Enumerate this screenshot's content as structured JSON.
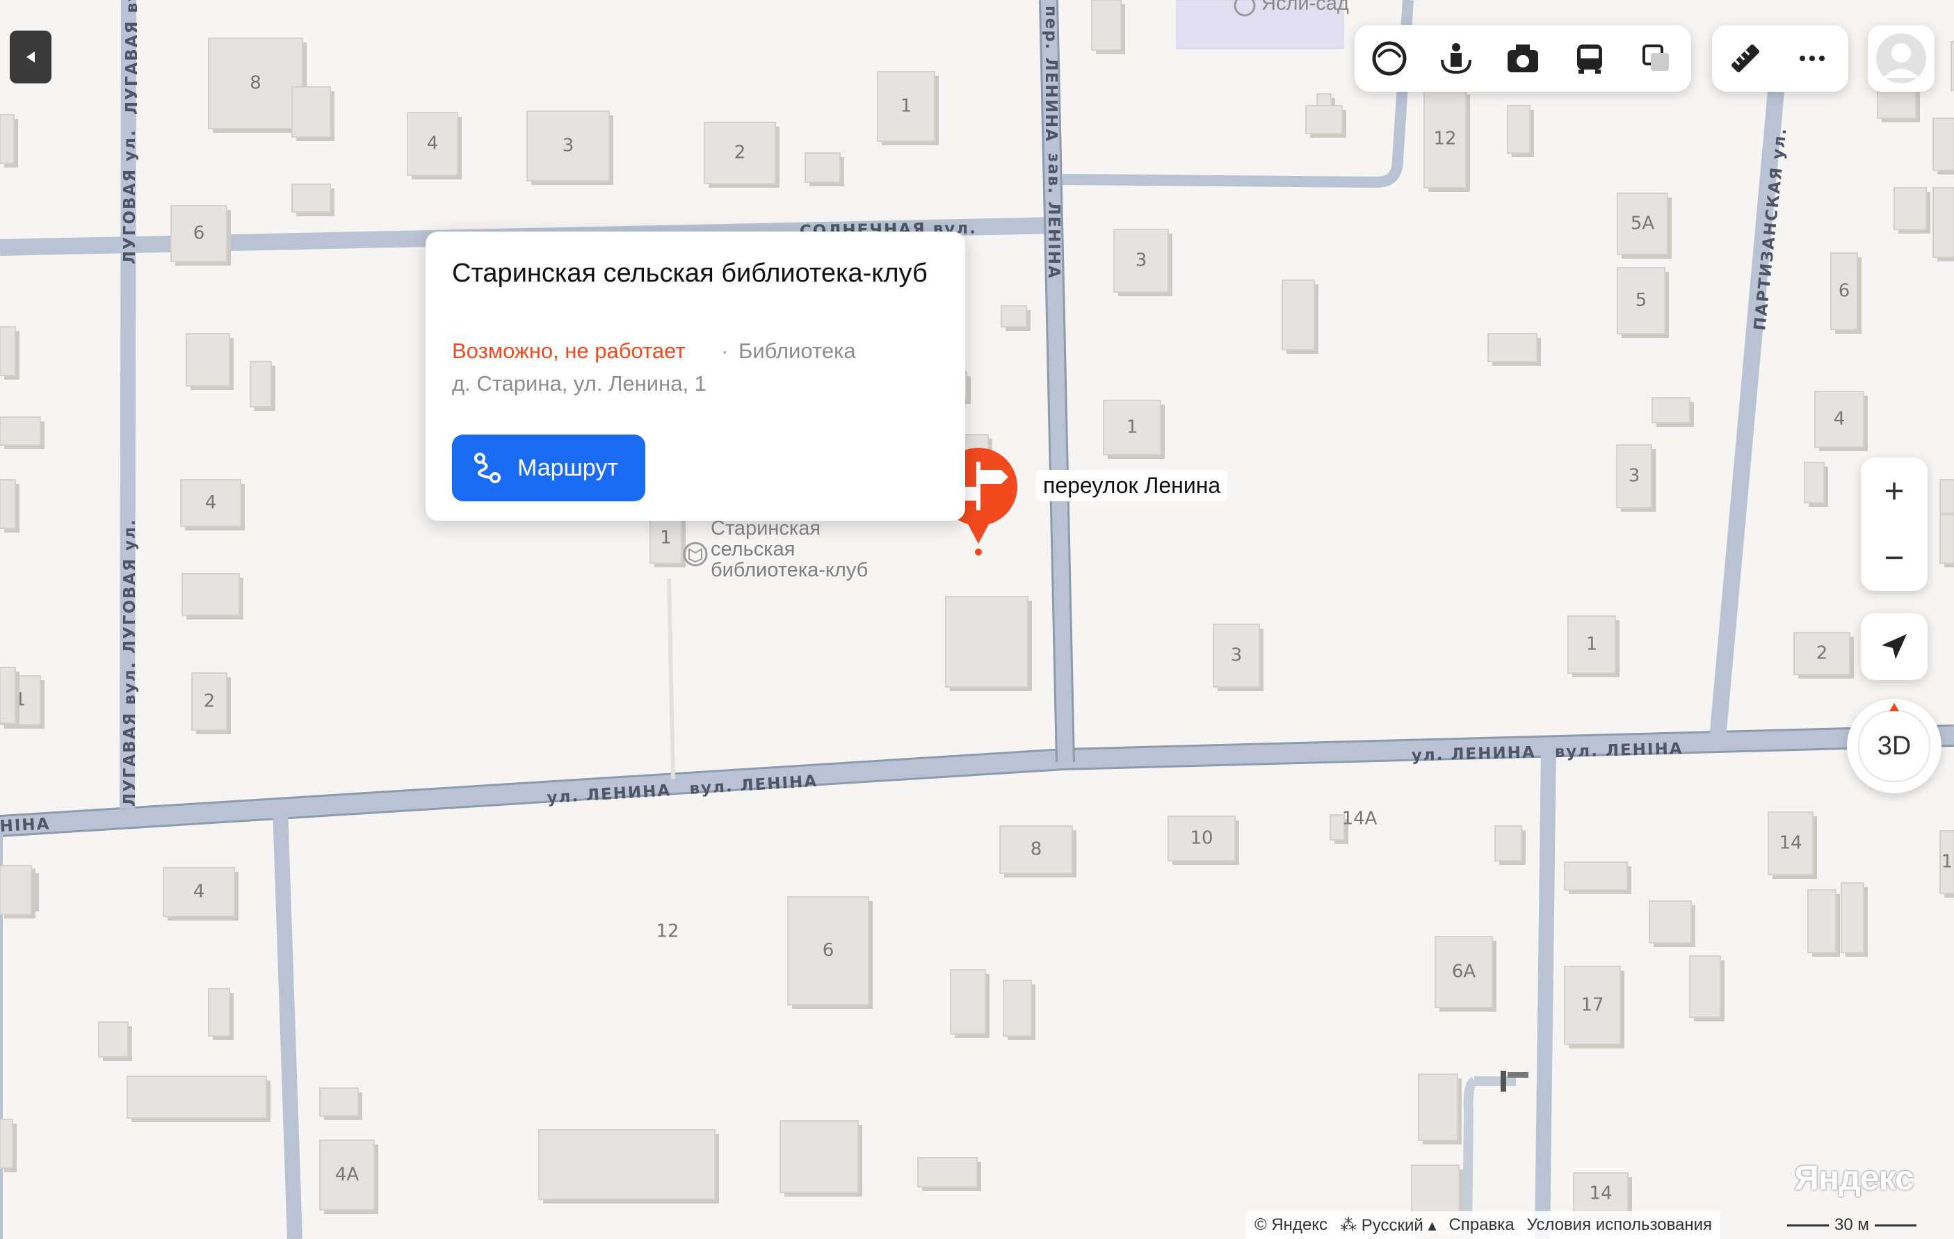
{
  "streets": {
    "lugovaya_1": "ЛУГОВАЯ ул.",
    "lugovaya_2": "ЛУГАВАЯ вул.",
    "lugovaya_3": "ЛУГОВАЯ ул.",
    "lugovaya_4": "ЛУГАВАЯ вул.",
    "lenina_ul": "ул. ЛЕНИНА",
    "lenina_vul": "вул. ЛЕНІНА",
    "lenina_ul_right": "ул. ЛЕНИНА",
    "lenina_vul_right": "вул. ЛЕНІНА",
    "pereulok_1": "пер. ЛЕНИНА",
    "pereulok_2": "зав. ЛЕНІНА",
    "solnechnaya": "СОЛНЕЧНАЯ вул.",
    "partizanskaya": "ПАРТИЗАНСКАЯ ул.",
    "nina_edge": "НІНА",
    "detsad": "Ясли-сад"
  },
  "house_numbers": [
    "8",
    "4",
    "3",
    "2",
    "1",
    "6",
    "4",
    "2",
    "1",
    "12",
    "5А",
    "5",
    "3",
    "1",
    "3",
    "1",
    "3",
    "6",
    "4",
    "2",
    "4",
    "2",
    "8",
    "10",
    "12",
    "6",
    "6А",
    "17",
    "14",
    "14А",
    "4А",
    "14",
    "1",
    "2",
    "8",
    "1"
  ],
  "card": {
    "title": "Старинская сельская библиотека-клуб",
    "status": "Возможно, не работает",
    "dot": "·",
    "category": "Библиотека",
    "address": "д. Старина, ул. Ленина, 1",
    "route_label": "Маршрут"
  },
  "pin_label": "переулок Ленина",
  "place_label": [
    "Старинская",
    "сельская",
    "библиотека-клуб"
  ],
  "controls": {
    "zoom_in": "+",
    "zoom_out": "−",
    "view_3d": "3D"
  },
  "footer": {
    "copyright": "© Яндекс",
    "language": "Русский",
    "help": "Справка",
    "terms": "Условия использования"
  },
  "logo": "Яндекс",
  "scale": "30 м",
  "colors": {
    "background": "#f7f5f3",
    "road": "#b9c3d3",
    "road_edge": "#8e9aae",
    "building": "#e6e2df",
    "accent_red": "#f2491f",
    "route_blue": "#1a6cf5"
  },
  "icons": [
    "back-arrow-icon",
    "alice-icon",
    "panorama-icon",
    "photo-icon",
    "bus-icon",
    "layers-icon",
    "ruler-icon",
    "more-icon",
    "user-avatar-icon",
    "route-icon",
    "signpost-pin-icon",
    "library-icon",
    "location-arrow-icon"
  ]
}
